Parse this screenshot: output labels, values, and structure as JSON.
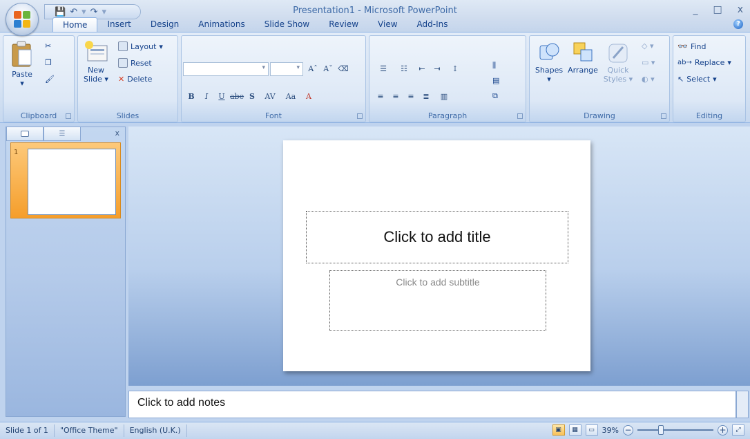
{
  "window": {
    "title": "Presentation1 - Microsoft PowerPoint",
    "controls": [
      "_",
      "□",
      "x"
    ]
  },
  "tabs": [
    "Home",
    "Insert",
    "Design",
    "Animations",
    "Slide Show",
    "Review",
    "View",
    "Add-Ins"
  ],
  "ribbon": {
    "clipboard": {
      "label": "Clipboard",
      "paste": "Paste"
    },
    "slides": {
      "label": "Slides",
      "new_slide_1": "New",
      "new_slide_2": "Slide",
      "layout": "Layout",
      "reset": "Reset",
      "delete": "Delete"
    },
    "font": {
      "label": "Font",
      "bold": "B",
      "italic": "I",
      "underline": "U",
      "strike": "abe",
      "shadow": "S",
      "spacing": "AV",
      "case": "Aa",
      "color": "A",
      "grow": "A",
      "shrink": "A"
    },
    "paragraph": {
      "label": "Paragraph"
    },
    "drawing": {
      "label": "Drawing",
      "shapes": "Shapes",
      "arrange": "Arrange",
      "quick_styles_1": "Quick",
      "quick_styles_2": "Styles"
    },
    "editing": {
      "label": "Editing",
      "find": "Find",
      "replace": "Replace",
      "select": "Select"
    }
  },
  "slides_pane": {
    "slide_number": "1"
  },
  "slide": {
    "title_placeholder": "Click to add title",
    "subtitle_placeholder": "Click to add subtitle"
  },
  "notes": {
    "placeholder": "Click to add notes"
  },
  "status": {
    "slide": "Slide 1 of 1",
    "theme": "\"Office Theme\"",
    "language": "English (U.K.)",
    "zoom": "39%"
  }
}
